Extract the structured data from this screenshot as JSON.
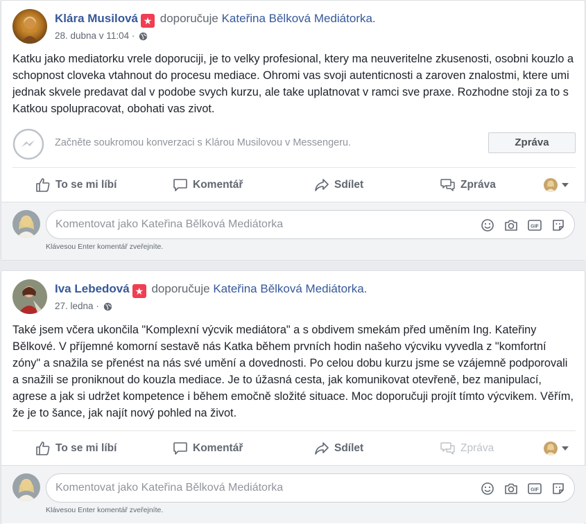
{
  "posts": [
    {
      "author": "Klára Musilová",
      "verb": "doporučuje",
      "page": "Kateřina Bělková Mediátorka.",
      "date": "28. dubna v 11:04",
      "separator": "·",
      "text": "Katku jako mediatorku vrele doporuciji, je to velky profesional, ktery ma neuveritelne zkusenosti, osobni kouzlo a schopnost cloveka vtahnout do procesu mediace. Ohromi vas svoji autenticnosti a zaroven znalostmi, ktere umi jednak skvele predavat dal v podobe svych kurzu, ale take uplatnovat v ramci sve praxe. Rozhodne stoji za to s Katkou spolupracovat, obohati vas zivot.",
      "messenger_prompt": "Začněte soukromou konverzaci s Klárou Musilovou v Messengeru.",
      "messenger_button": "Zpráva",
      "actions": {
        "like": "To se mi líbí",
        "comment": "Komentář",
        "share": "Sdílet",
        "message": "Zpráva"
      },
      "comment_placeholder": "Komentovat jako Kateřina Bělková Mediátorka",
      "comment_hint": "Klávesou Enter komentář zveřejníte."
    },
    {
      "author": "Iva Lebedová",
      "verb": "doporučuje",
      "page": "Kateřina Bělková Mediátorka.",
      "date": "27. ledna",
      "separator": "·",
      "text": "Také jsem včera ukončila \"Komplexní výcvik mediátora\" a s obdivem smekám před uměním Ing. Kateřiny Bělkové. V příjemné komorní sestavě nás Katka během prvních hodin našeho výcviku vyvedla z \"komfortní zóny\" a snažila se přenést na nás své umění a dovednosti. Po celou dobu kurzu jsme se vzájemně podporovali a snažili se proniknout do kouzla mediace. Je to úžasná cesta, jak komunikovat otevřeně, bez manipulací, agrese a jak si udržet kompetence i během emočně složité situace. Moc doporučuji projít tímto výcvikem. Věřím, že je to šance, jak najít nový pohled na život.",
      "actions": {
        "like": "To se mi líbí",
        "comment": "Komentář",
        "share": "Sdílet",
        "message": "Zpráva"
      },
      "comment_placeholder": "Komentovat jako Kateřina Bělková Mediátorka",
      "comment_hint": "Klávesou Enter komentář zveřejníte."
    }
  ],
  "colors": {
    "link": "#365899",
    "badge": "#f03e52",
    "secondary": "#606770",
    "muted": "#90949c"
  },
  "icons": [
    "star-badge-icon",
    "globe-icon",
    "messenger-icon",
    "like-icon",
    "comment-icon",
    "share-icon",
    "message-icon",
    "emoji-icon",
    "camera-icon",
    "gif-icon",
    "sticker-icon",
    "caret-down-icon"
  ]
}
